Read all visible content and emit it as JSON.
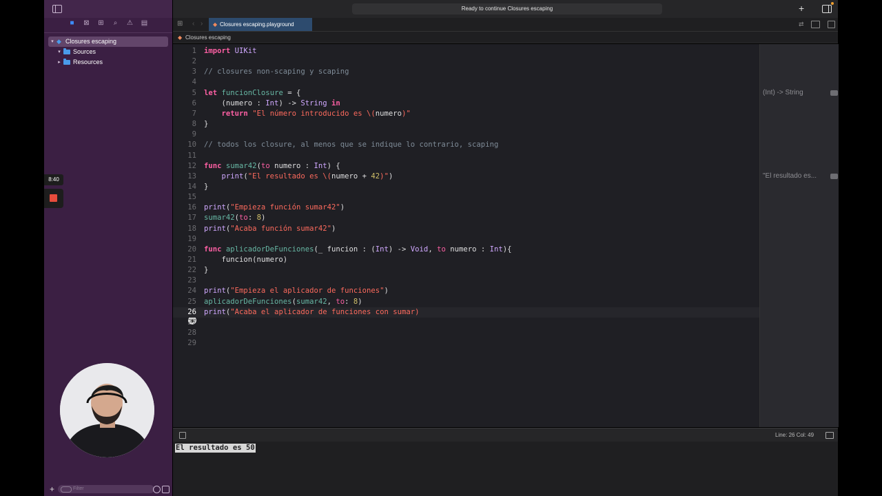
{
  "window": {
    "status": "Ready to continue Closures escaping"
  },
  "tab": {
    "label": "Closures escaping.playground"
  },
  "breadcrumb": {
    "label": "Closures escaping"
  },
  "sidebar": {
    "tree": [
      {
        "label": "Closures escaping",
        "level": 0,
        "expanded": true,
        "selected": true,
        "icon": "swift-icon"
      },
      {
        "label": "Sources",
        "level": 1,
        "expanded": true,
        "icon": "folder-icon"
      },
      {
        "label": "Resources",
        "level": 1,
        "expanded": false,
        "icon": "folder-icon"
      }
    ],
    "filter_placeholder": "Filter"
  },
  "recording": {
    "timer": "8:40"
  },
  "editor": {
    "current_line": 26,
    "lines": [
      "import UIKit",
      "",
      "// closures non-scaping y scaping",
      "",
      "let funcionClosure = {",
      "    (numero : Int) -> String in",
      "    return \"El número introducido es \\(numero)\"",
      "}",
      "",
      "// todos los closure, al menos que se indique lo contrario, scaping",
      "",
      "func sumar42(to numero : Int) {",
      "    print(\"El resultado es \\(numero + 42)\")",
      "}",
      "",
      "print(\"Empieza función sumar42\")",
      "sumar42(to: 8)",
      "print(\"Acaba función sumar42\")",
      "",
      "func aplicadorDeFunciones(_ funcion : (Int) -> Void, to numero : Int){",
      "    funcion(numero)",
      "}",
      "",
      "print(\"Empieza el aplicador de funciones\")",
      "aplicadorDeFunciones(sumar42, to: 8)",
      "print(\"Acaba el aplicador de funciones con sumar)",
      "",
      "",
      ""
    ]
  },
  "results": [
    {
      "line": 5,
      "text": "(Int) -> String"
    },
    {
      "line": 13,
      "text": "\"El resultado es..."
    }
  ],
  "debug": {
    "position": "Line: 26  Col: 49"
  },
  "console": {
    "output": "El resultado es 50"
  },
  "colors": {
    "keyword": "#fc5fa3",
    "comment": "#7f8c98",
    "string": "#fc6a5d",
    "number": "#d0bf69",
    "type": "#d0a8ff",
    "function": "#67b7a4",
    "sidebar": "#3b1f43",
    "editor_bg": "#1f1f24",
    "accent": "#3d8cff"
  }
}
